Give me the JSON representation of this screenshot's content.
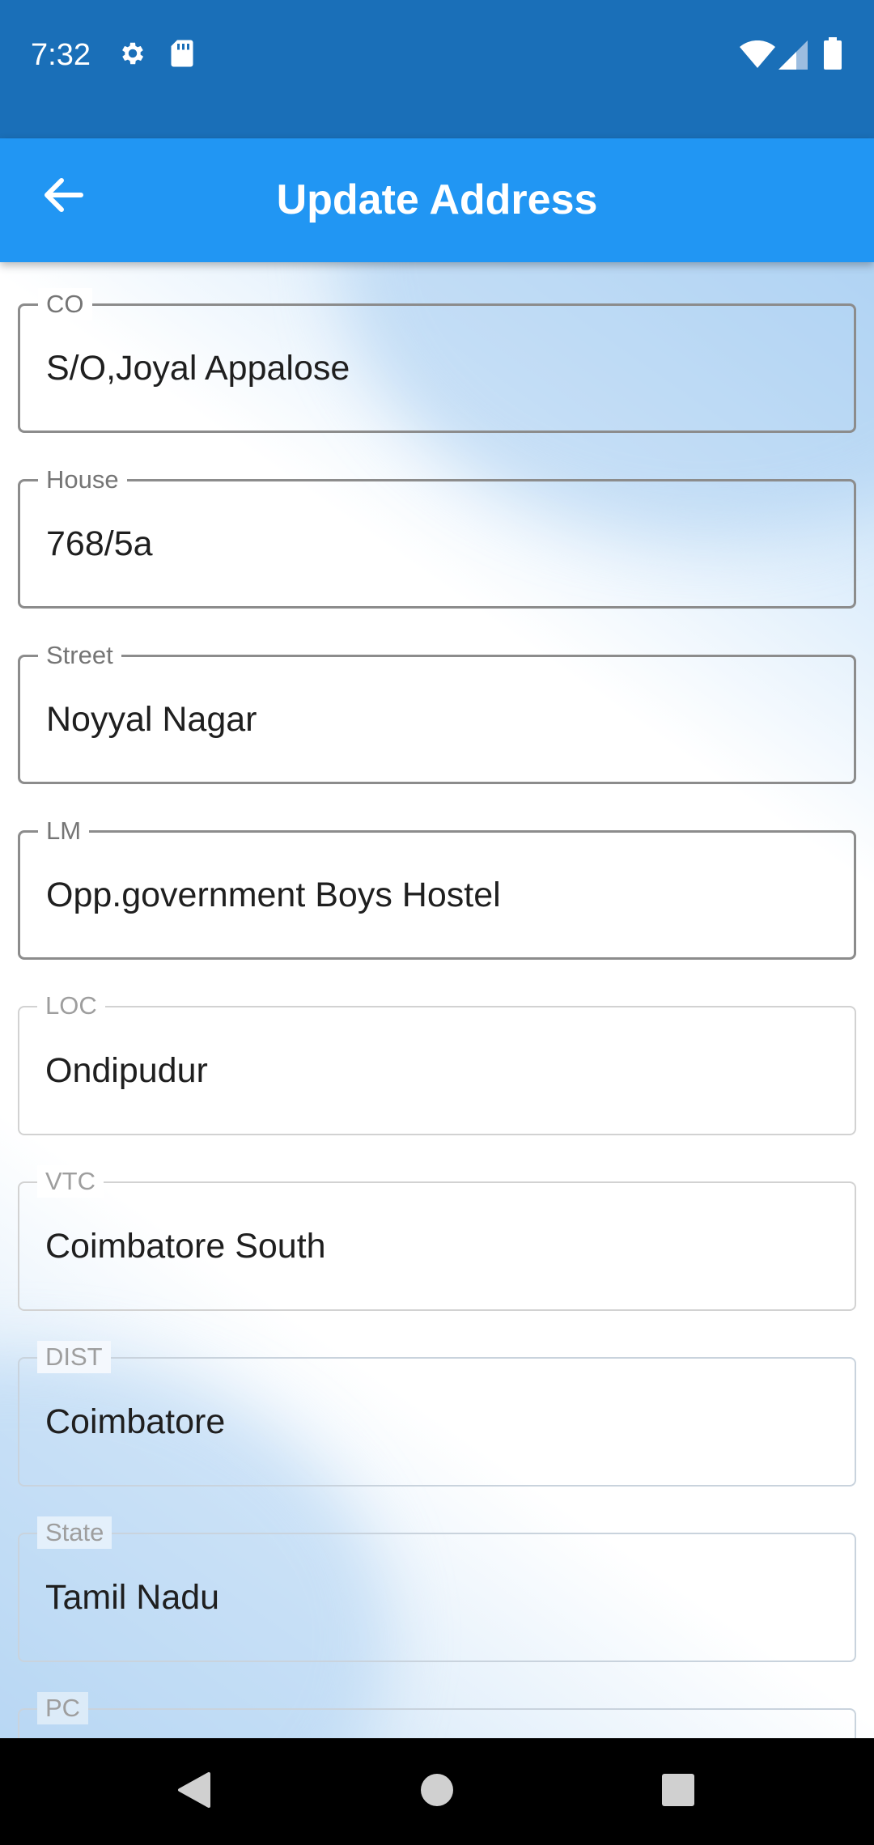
{
  "status_bar": {
    "time": "7:32",
    "icons": [
      "gear-icon",
      "sd-card-icon",
      "wifi-icon",
      "signal-icon",
      "battery-icon"
    ]
  },
  "app_bar": {
    "title": "Update Address",
    "back_icon": "arrow-back-icon"
  },
  "fields": [
    {
      "label": "CO",
      "value": "S/O,Joyal Appalose"
    },
    {
      "label": "House",
      "value": "768/5a"
    },
    {
      "label": "Street",
      "value": "Noyyal Nagar"
    },
    {
      "label": "LM",
      "value": "Opp.government Boys Hostel"
    },
    {
      "label": "LOC",
      "value": "Ondipudur"
    },
    {
      "label": "VTC",
      "value": "Coimbatore South"
    },
    {
      "label": "DIST",
      "value": "Coimbatore"
    },
    {
      "label": "State",
      "value": "Tamil Nadu"
    },
    {
      "label": "PC",
      "value": ""
    }
  ],
  "nav_bar": {
    "icons": [
      "back-triangle-icon",
      "home-circle-icon",
      "recents-square-icon"
    ]
  },
  "colors": {
    "status_bar": "#1a6fb8",
    "app_bar": "#2196f3",
    "active_border": "#8c8c8c",
    "muted_border": "#d2d2d2"
  }
}
